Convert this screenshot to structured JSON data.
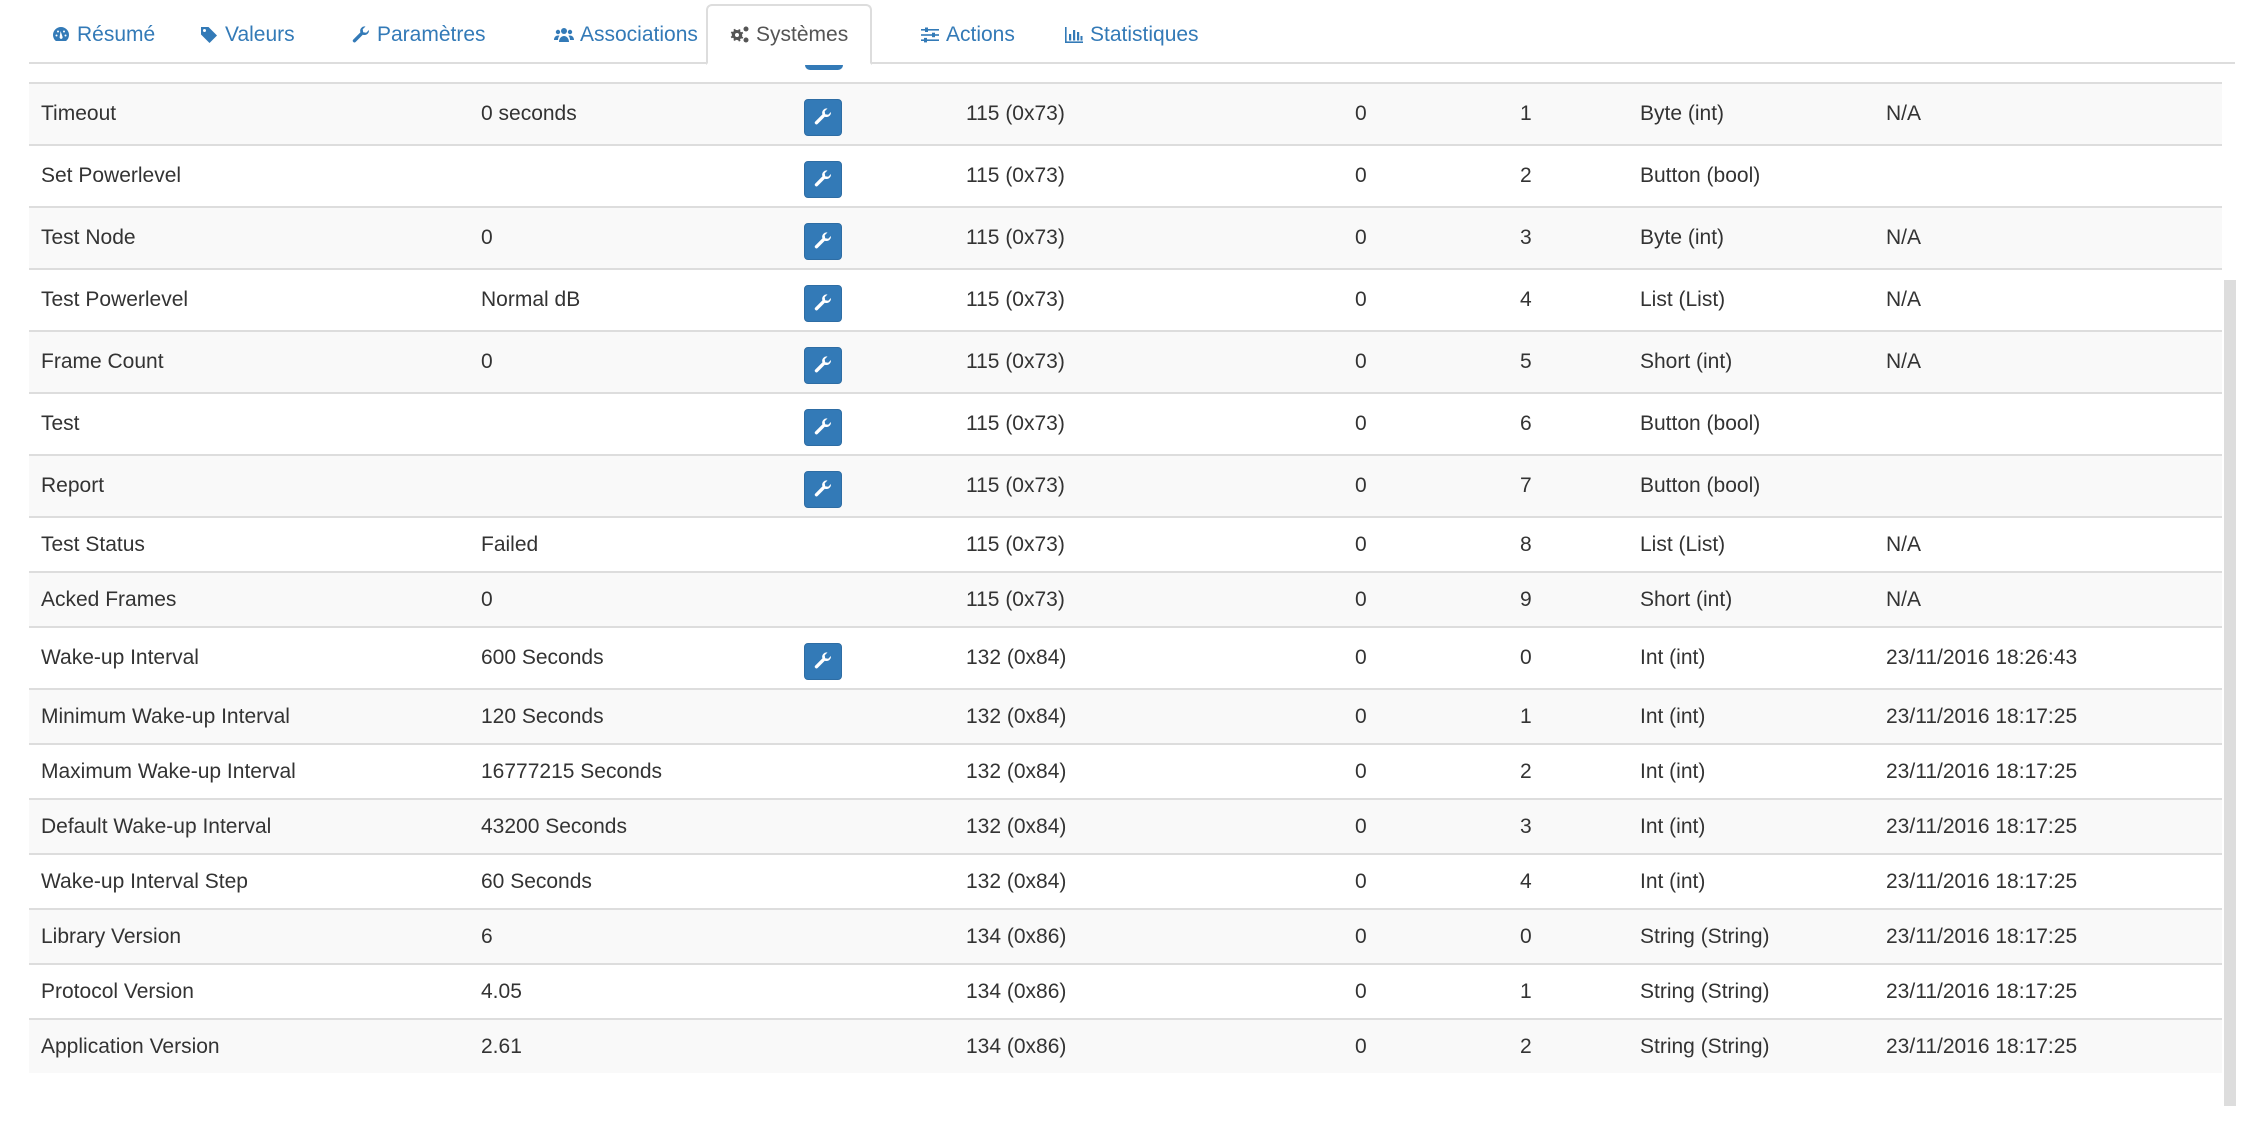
{
  "tabs": [
    {
      "label": "Résumé",
      "icon": "dashboard-icon",
      "active": false
    },
    {
      "label": "Valeurs",
      "icon": "tag-icon",
      "active": false
    },
    {
      "label": "Paramètres",
      "icon": "wrench-icon",
      "active": false
    },
    {
      "label": "Associations",
      "icon": "users-icon",
      "active": false
    },
    {
      "label": "Systèmes",
      "icon": "cogs-icon",
      "active": true
    },
    {
      "label": "Actions",
      "icon": "sliders-icon",
      "active": false
    },
    {
      "label": "Statistiques",
      "icon": "bar-chart-icon",
      "active": false
    }
  ],
  "colors": {
    "accent": "#337ab7",
    "border": "#dddddd",
    "stripe": "#f9f9f9",
    "text": "#333333"
  },
  "rows": [
    {
      "name": "Timeout",
      "value": "0 seconds",
      "editable": true,
      "class": "115 (0x73)",
      "instance": "0",
      "index": "1",
      "type": "Byte (int)",
      "updated": "N/A"
    },
    {
      "name": "Set Powerlevel",
      "value": "",
      "editable": true,
      "class": "115 (0x73)",
      "instance": "0",
      "index": "2",
      "type": "Button (bool)",
      "updated": ""
    },
    {
      "name": "Test Node",
      "value": "0",
      "editable": true,
      "class": "115 (0x73)",
      "instance": "0",
      "index": "3",
      "type": "Byte (int)",
      "updated": "N/A"
    },
    {
      "name": "Test Powerlevel",
      "value": "Normal dB",
      "editable": true,
      "class": "115 (0x73)",
      "instance": "0",
      "index": "4",
      "type": "List (List)",
      "updated": "N/A"
    },
    {
      "name": "Frame Count",
      "value": "0",
      "editable": true,
      "class": "115 (0x73)",
      "instance": "0",
      "index": "5",
      "type": "Short (int)",
      "updated": "N/A"
    },
    {
      "name": "Test",
      "value": "",
      "editable": true,
      "class": "115 (0x73)",
      "instance": "0",
      "index": "6",
      "type": "Button (bool)",
      "updated": ""
    },
    {
      "name": "Report",
      "value": "",
      "editable": true,
      "class": "115 (0x73)",
      "instance": "0",
      "index": "7",
      "type": "Button (bool)",
      "updated": ""
    },
    {
      "name": "Test Status",
      "value": "Failed",
      "editable": false,
      "class": "115 (0x73)",
      "instance": "0",
      "index": "8",
      "type": "List (List)",
      "updated": "N/A"
    },
    {
      "name": "Acked Frames",
      "value": "0",
      "editable": false,
      "class": "115 (0x73)",
      "instance": "0",
      "index": "9",
      "type": "Short (int)",
      "updated": "N/A"
    },
    {
      "name": "Wake-up Interval",
      "value": "600 Seconds",
      "editable": true,
      "class": "132 (0x84)",
      "instance": "0",
      "index": "0",
      "type": "Int (int)",
      "updated": "23/11/2016 18:26:43"
    },
    {
      "name": "Minimum Wake-up Interval",
      "value": "120 Seconds",
      "editable": false,
      "class": "132 (0x84)",
      "instance": "0",
      "index": "1",
      "type": "Int (int)",
      "updated": "23/11/2016 18:17:25"
    },
    {
      "name": "Maximum Wake-up Interval",
      "value": "16777215 Seconds",
      "editable": false,
      "class": "132 (0x84)",
      "instance": "0",
      "index": "2",
      "type": "Int (int)",
      "updated": "23/11/2016 18:17:25"
    },
    {
      "name": "Default Wake-up Interval",
      "value": "43200 Seconds",
      "editable": false,
      "class": "132 (0x84)",
      "instance": "0",
      "index": "3",
      "type": "Int (int)",
      "updated": "23/11/2016 18:17:25"
    },
    {
      "name": "Wake-up Interval Step",
      "value": "60 Seconds",
      "editable": false,
      "class": "132 (0x84)",
      "instance": "0",
      "index": "4",
      "type": "Int (int)",
      "updated": "23/11/2016 18:17:25"
    },
    {
      "name": "Library Version",
      "value": "6",
      "editable": false,
      "class": "134 (0x86)",
      "instance": "0",
      "index": "0",
      "type": "String (String)",
      "updated": "23/11/2016 18:17:25"
    },
    {
      "name": "Protocol Version",
      "value": "4.05",
      "editable": false,
      "class": "134 (0x86)",
      "instance": "0",
      "index": "1",
      "type": "String (String)",
      "updated": "23/11/2016 18:17:25"
    },
    {
      "name": "Application Version",
      "value": "2.61",
      "editable": false,
      "class": "134 (0x86)",
      "instance": "0",
      "index": "2",
      "type": "String (String)",
      "updated": "23/11/2016 18:17:25"
    }
  ]
}
